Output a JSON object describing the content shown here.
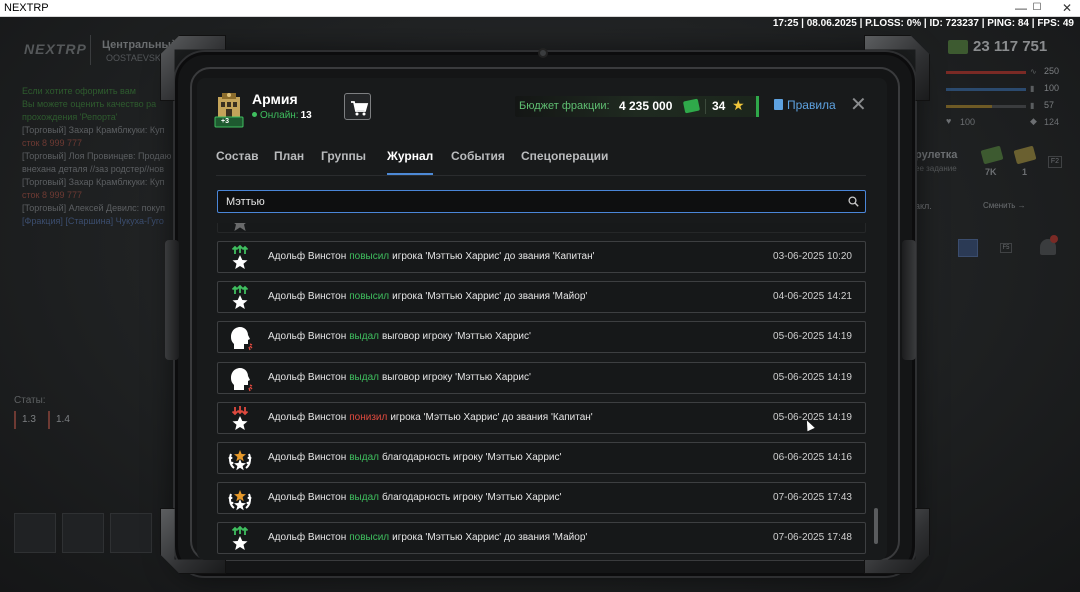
{
  "window": {
    "title": "NEXTRP",
    "minimize": "—",
    "maximize": "☐",
    "close": "✕"
  },
  "statusline": "17:25 | 08.06.2025 | P.LOSS: 0% | ID: 723237 | PING: 84 | FPS: 49",
  "background": {
    "logo": "NEXTRP",
    "server": "Центральный",
    "server_sub": "OOSTAEVSK",
    "chat": [
      {
        "text": "Если хотите оформить вам",
        "cls": "g"
      },
      {
        "text": "Вы можете оценить качество ра",
        "cls": "g"
      },
      {
        "text": "прохождения 'Репорта'",
        "cls": "g"
      },
      {
        "text": "[Торговый] Захар Крамблкуки: Куп",
        "cls": "n"
      },
      {
        "text": "сток  8 999 777",
        "cls": "r"
      },
      {
        "text": "[Торговый] Лоя Провинцев: Продаю",
        "cls": "n"
      },
      {
        "text": "внехана деталя //заз родстер//нов",
        "cls": "n"
      },
      {
        "text": "[Торговый] Захар Крамблкуки: Куп",
        "cls": "n"
      },
      {
        "text": "сток  8 999 777",
        "cls": "r"
      },
      {
        "text": "[Торговый] Алексей Девилс: покуп",
        "cls": "n"
      },
      {
        "text": "[Фракция] [Старшина] Чукуха-Гуго",
        "cls": "b"
      }
    ],
    "stats_label": "Статы:",
    "stats": [
      "1.3",
      "1.4"
    ],
    "money": "23 117 751",
    "bars": [
      {
        "value": "250",
        "color": "#7a2a25",
        "fill": 1.0
      },
      {
        "value": "100",
        "color": "#2b4a6e",
        "fill": 1.0
      },
      {
        "value": "57",
        "color": "#6e5a25",
        "fill": 0.57
      }
    ],
    "hp": "100",
    "armor": "124",
    "quest": "рулетка",
    "quest_sub": "ее задание",
    "cash1": "7K",
    "cash2": "1",
    "f2": "F2",
    "recl": "акл.",
    "swap": "Сменить →",
    "f5": "F5"
  },
  "faction": {
    "name": "Армия",
    "online_label": "Онлайн:",
    "online_count": "13",
    "badge": "+3"
  },
  "budget": {
    "label": "Бюджет фракции:",
    "value": "4 235 000",
    "stars": "34"
  },
  "rules": "Правила",
  "tabs": [
    {
      "label": "Состав"
    },
    {
      "label": "План"
    },
    {
      "label": "Группы"
    },
    {
      "label": "Журнал",
      "active": true
    },
    {
      "label": "События"
    },
    {
      "label": "Спецоперации"
    }
  ],
  "search": {
    "value": "Мэттью",
    "placeholder": ""
  },
  "log": [
    {
      "icon": "rank-up",
      "actor": "Адольф Винстон",
      "verb": "повысил",
      "verb_color": "green",
      "rest": "игрока 'Мэттью Харрис' до звания 'Капитан'",
      "date": "03-06-2025 10:20"
    },
    {
      "icon": "rank-up",
      "actor": "Адольф Винстон",
      "verb": "повысил",
      "verb_color": "green",
      "rest": "игрока 'Мэттью Харрис' до звания 'Майор'",
      "date": "04-06-2025 14:21"
    },
    {
      "icon": "reprimand",
      "actor": "Адольф Винстон",
      "verb": "выдал",
      "verb_color": "green",
      "rest": "выговор игроку 'Мэттью Харрис'",
      "date": "05-06-2025 14:19"
    },
    {
      "icon": "reprimand",
      "actor": "Адольф Винстон",
      "verb": "выдал",
      "verb_color": "green",
      "rest": "выговор игроку 'Мэттью Харрис'",
      "date": "05-06-2025 14:19"
    },
    {
      "icon": "rank-down",
      "actor": "Адольф Винстон",
      "verb": "понизил",
      "verb_color": "red",
      "rest": "игрока 'Мэттью Харрис' до звания 'Капитан'",
      "date": "05-06-2025 14:19"
    },
    {
      "icon": "gratitude",
      "actor": "Адольф Винстон",
      "verb": "выдал",
      "verb_color": "green",
      "rest": "благодарность игроку 'Мэттью Харрис'",
      "date": "06-06-2025 14:16"
    },
    {
      "icon": "gratitude",
      "actor": "Адольф Винстон",
      "verb": "выдал",
      "verb_color": "green",
      "rest": "благодарность игроку 'Мэттью Харрис'",
      "date": "07-06-2025 17:43"
    },
    {
      "icon": "rank-up",
      "actor": "Адольф Винстон",
      "verb": "повысил",
      "verb_color": "green",
      "rest": "игрока 'Мэттью Харрис' до звания 'Майор'",
      "date": "07-06-2025 17:48"
    }
  ]
}
